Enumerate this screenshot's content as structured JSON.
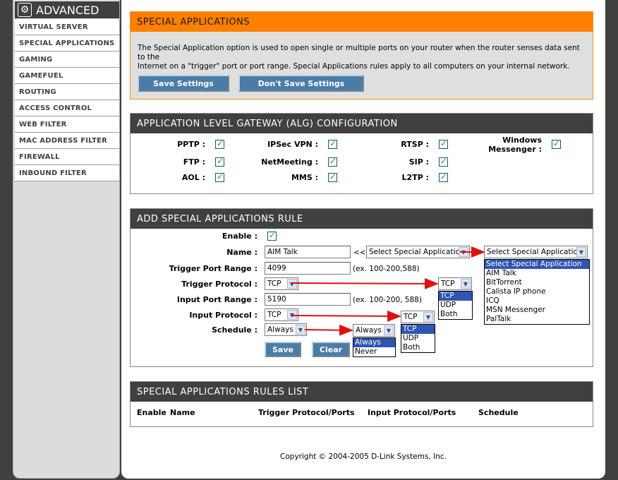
{
  "sidebar": {
    "header": "ADVANCED",
    "items": [
      "VIRTUAL SERVER",
      "SPECIAL APPLICATIONS",
      "GAMING",
      "GAMEFUEL",
      "ROUTING",
      "ACCESS CONTROL",
      "WEB FILTER",
      "MAC ADDRESS FILTER",
      "FIREWALL",
      "INBOUND FILTER"
    ]
  },
  "special": {
    "title": "SPECIAL APPLICATIONS",
    "desc1": "The Special Application option is used to open single or multiple ports on your router when the router senses data sent to the",
    "desc2": "Internet on a \"trigger\" port or port range. Special Applications rules apply to all computers on your internal network.",
    "save": "Save Settings",
    "nosave": "Don't Save Settings"
  },
  "alg": {
    "title": "APPLICATION LEVEL GATEWAY (ALG) CONFIGURATION",
    "pptp": "PPTP :",
    "ipsec": "IPSec VPN :",
    "rtsp": "RTSP :",
    "wm1": "Windows",
    "wm2": "Messenger :",
    "ftp": "FTP :",
    "netmeeting": "NetMeeting :",
    "sip": "SIP :",
    "aol": "AOL :",
    "mms": "MMS :",
    "l2tp": "L2TP :"
  },
  "rule": {
    "title": "ADD SPECIAL APPLICATIONS RULE",
    "enable_label": "Enable :",
    "name_label": "Name :",
    "name_value": "AIM Talk",
    "arrows": "<<",
    "app_select": "Select Special Application",
    "trig_range_label": "Trigger Port Range :",
    "trig_range_value": "4099",
    "trig_range_hint": "(ex. 100-200,588)",
    "trig_proto_label": "Trigger Protocol :",
    "trig_proto_value": "TCP",
    "in_range_label": "Input Port Range :",
    "in_range_value": "5190",
    "in_range_hint": "(ex. 100-200, 588)",
    "in_proto_label": "Input Protocol :",
    "in_proto_value": "TCP",
    "schedule_label": "Schedule :",
    "schedule_value": "Always",
    "save": "Save",
    "clear": "Clear",
    "app_options": [
      "Select Special Application",
      "AIM Talk",
      "BitTorrent",
      "Calista IP phone",
      "ICQ",
      "MSN Messenger",
      "PalTalk"
    ],
    "proto_options": [
      "TCP",
      "UDP",
      "Both"
    ],
    "schedule_options": [
      "Always",
      "Never"
    ]
  },
  "list": {
    "title": "SPECIAL APPLICATIONS RULES LIST",
    "cols": [
      "Enable",
      "Name",
      "Trigger Protocol/Ports",
      "Input Protocol/Ports",
      "Schedule"
    ]
  },
  "copyright": "Copyright © 2004-2005 D-Link Systems, Inc.",
  "colors": {
    "accent": "#ff7f00",
    "header_dark": "#404040",
    "button": "#4a7ca8",
    "arrow": "#e01010"
  }
}
